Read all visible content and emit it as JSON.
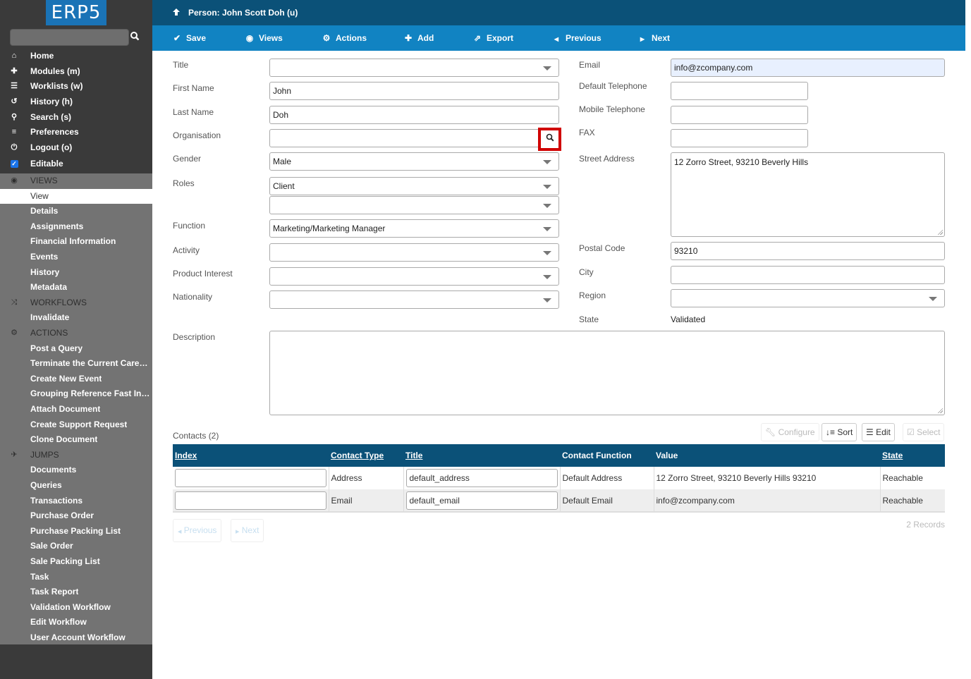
{
  "app": {
    "logo": "ERP5",
    "brand_color": "#1a73b6",
    "header_color": "#0b5178",
    "toolbar_color": "#1183c2"
  },
  "sidebar": {
    "search": {
      "value": "",
      "placeholder": ""
    },
    "nav": [
      {
        "label": "Home",
        "icon": "home-icon",
        "glyph": "⌂"
      },
      {
        "label": "Modules (m)",
        "icon": "puzzle-icon",
        "glyph": "✚"
      },
      {
        "label": "Worklists (w)",
        "icon": "list-icon",
        "glyph": "☰"
      },
      {
        "label": "History (h)",
        "icon": "history-icon",
        "glyph": "↺"
      },
      {
        "label": "Search (s)",
        "icon": "search-icon",
        "glyph": "⚲"
      },
      {
        "label": "Preferences",
        "icon": "sliders-icon",
        "glyph": "≡"
      },
      {
        "label": "Logout (o)",
        "icon": "power-icon",
        "glyph": "⏻"
      },
      {
        "label": "Editable",
        "icon": "checkbox-icon",
        "glyph": "☑",
        "checked": true
      }
    ],
    "sections": {
      "views": {
        "header": "VIEWS",
        "icon": "eye-icon",
        "items": [
          "View",
          "Details",
          "Assignments",
          "Financial Information",
          "Events",
          "History",
          "Metadata"
        ],
        "active": "View"
      },
      "workflows": {
        "header": "WORKFLOWS",
        "icon": "shuffle-icon",
        "items": [
          "Invalidate"
        ]
      },
      "actions": {
        "header": "ACTIONS",
        "icon": "cogs-icon",
        "items": [
          "Post a Query",
          "Terminate the Current Career...",
          "Create New Event",
          "Grouping Reference Fast Input",
          "Attach Document",
          "Create Support Request",
          "Clone Document"
        ]
      },
      "jumps": {
        "header": "JUMPS",
        "icon": "plane-icon",
        "items": [
          "Documents",
          "Queries",
          "Transactions",
          "Purchase Order",
          "Purchase Packing List",
          "Sale Order",
          "Sale Packing List",
          "Task",
          "Task Report",
          "Validation Workflow",
          "Edit Workflow",
          "User Account Workflow"
        ]
      }
    }
  },
  "header": {
    "title": "Person: John Scott Doh (u)"
  },
  "toolbar": {
    "save": "Save",
    "views": "Views",
    "actions": "Actions",
    "add": "Add",
    "export": "Export",
    "previous": "Previous",
    "next": "Next"
  },
  "form": {
    "left": {
      "title": {
        "label": "Title",
        "value": ""
      },
      "first_name": {
        "label": "First Name",
        "value": "John"
      },
      "last_name": {
        "label": "Last Name",
        "value": "Doh"
      },
      "organisation": {
        "label": "Organisation",
        "value": ""
      },
      "gender": {
        "label": "Gender",
        "value": "Male"
      },
      "roles": {
        "label": "Roles",
        "value": "Client",
        "value2": ""
      },
      "function": {
        "label": "Function",
        "value": "Marketing/Marketing Manager"
      },
      "activity": {
        "label": "Activity",
        "value": ""
      },
      "product_interest": {
        "label": "Product Interest",
        "value": ""
      },
      "nationality": {
        "label": "Nationality",
        "value": ""
      }
    },
    "right": {
      "email": {
        "label": "Email",
        "value": "info@zcompany.com"
      },
      "default_telephone": {
        "label": "Default Telephone",
        "value": ""
      },
      "mobile_telephone": {
        "label": "Mobile Telephone",
        "value": ""
      },
      "fax": {
        "label": "FAX",
        "value": ""
      },
      "street_address": {
        "label": "Street Address",
        "value": "12 Zorro Street, 93210 Beverly Hills"
      },
      "postal_code": {
        "label": "Postal Code",
        "value": "93210"
      },
      "city": {
        "label": "City",
        "value": ""
      },
      "region": {
        "label": "Region",
        "value": ""
      },
      "state": {
        "label": "State",
        "value": "Validated"
      }
    },
    "description": {
      "label": "Description",
      "value": ""
    }
  },
  "contacts": {
    "title": "Contacts (2)",
    "buttons": {
      "configure": "Configure",
      "sort": "Sort",
      "edit": "Edit",
      "select": "Select"
    },
    "columns": [
      "Index",
      "Contact Type",
      "Title",
      "Contact Function",
      "Value",
      "State"
    ],
    "rows": [
      {
        "index": "",
        "contact_type": "Address",
        "title": "default_address",
        "contact_function": "Default Address",
        "value": "12 Zorro Street, 93210 Beverly Hills 93210",
        "state": "Reachable"
      },
      {
        "index": "",
        "contact_type": "Email",
        "title": "default_email",
        "contact_function": "Default Email",
        "value": "info@zcompany.com",
        "state": "Reachable"
      }
    ],
    "pager": {
      "previous": "Previous",
      "next": "Next",
      "records": "2 Records"
    }
  }
}
